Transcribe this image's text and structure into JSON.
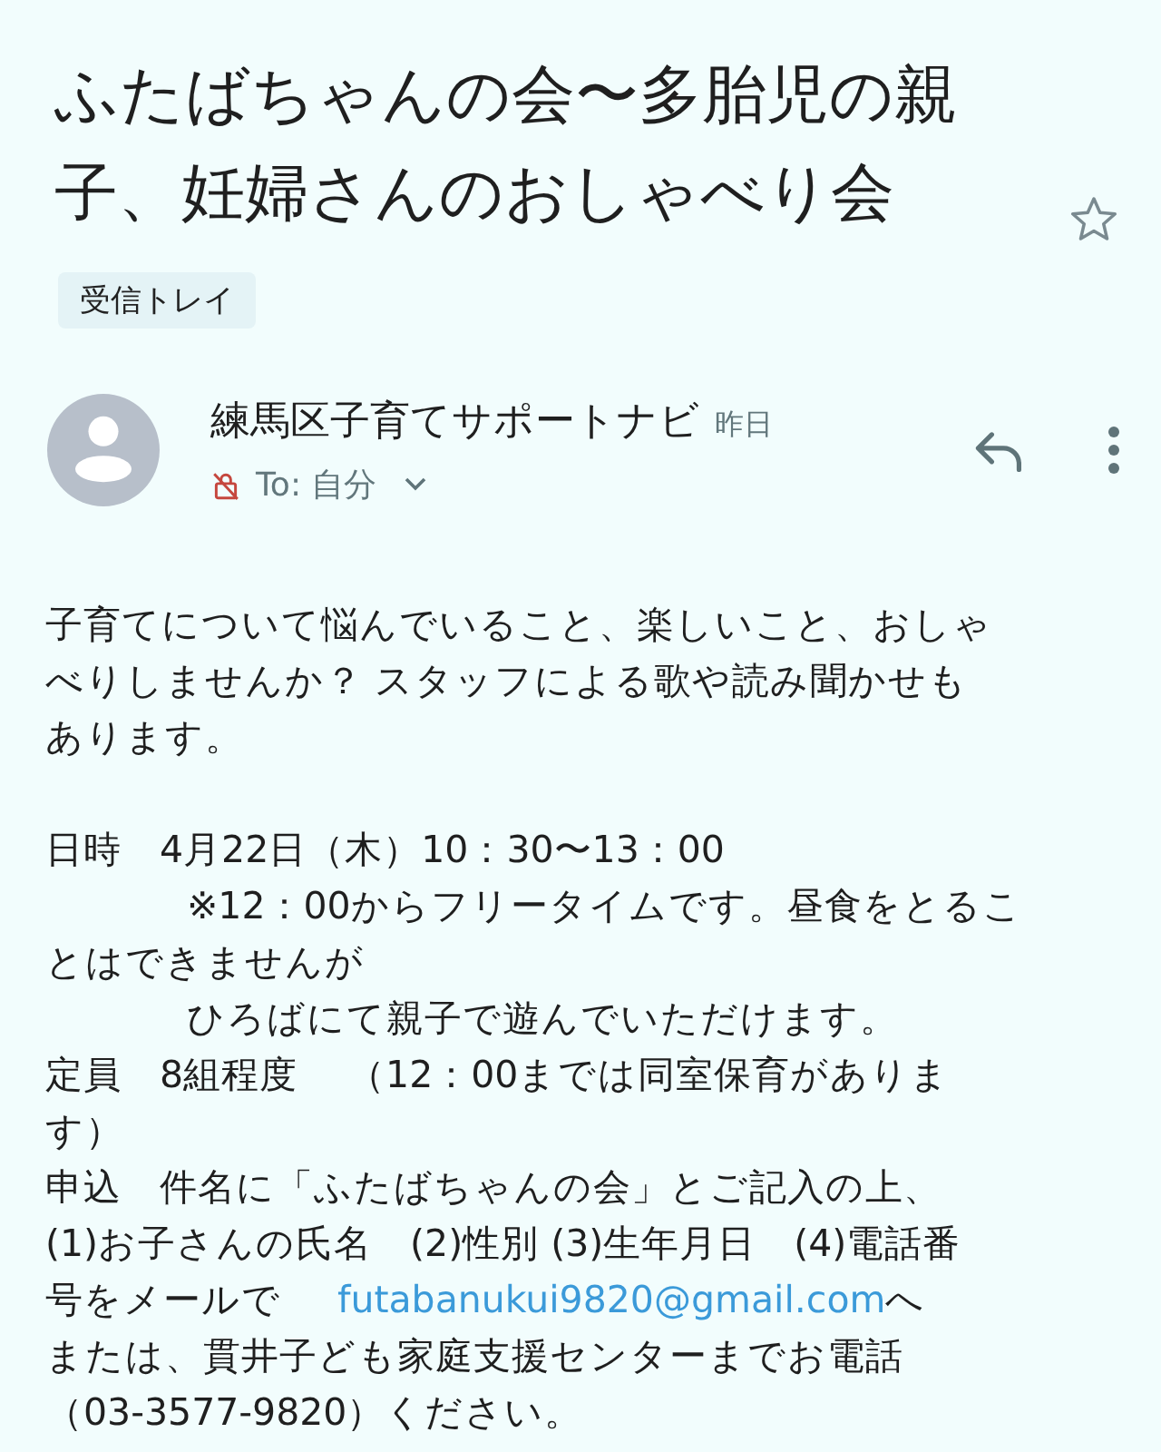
{
  "subject": "ふたばちゃんの会〜多胎児の親子、妊婦さんのおしゃべり会",
  "starred": false,
  "label": "受信トレイ",
  "sender": {
    "name": "練馬区子育てサポートナビ",
    "time": "昨日",
    "to": "To: 自分"
  },
  "body": [
    {
      "lines": [
        {
          "text": "子育てについて悩んでいること、楽しいこと、おしゃ",
          "indent": false
        },
        {
          "text": "べりしませんか？ スタッフによる歌や読み聞かせも",
          "indent": false
        },
        {
          "text": "あります。",
          "indent": false
        }
      ]
    },
    {
      "lines": [
        {
          "text": "日時　4月22日（木）10：30〜13：00",
          "indent": false
        },
        {
          "text": "※12：00からフリータイムです。昼食をとるこ",
          "indent": true
        },
        {
          "text": "とはできませんが",
          "indent": false
        },
        {
          "text": "ひろばにて親子で遊んでいただけます。",
          "indent": true
        },
        {
          "text": "定員　8組程度　 （12：00までは同室保育がありま",
          "indent": false
        },
        {
          "text": "す）",
          "indent": false
        },
        {
          "text": "申込　件名に「ふたばちゃんの会」とご記入の上、",
          "indent": false
        },
        {
          "text": "(1)お子さんの氏名　(2)性別 (3)生年月日　(4)電話番",
          "indent": false
        },
        {
          "text": "号をメールで　",
          "link": "futabanukui9820@gmail.com",
          "after": "へ",
          "indent": false
        },
        {
          "text": "または、貫井子ども家庭支援センターまでお電話",
          "indent": false
        },
        {
          "text": "（03-3577-9820）ください。",
          "indent": false
        }
      ]
    }
  ]
}
